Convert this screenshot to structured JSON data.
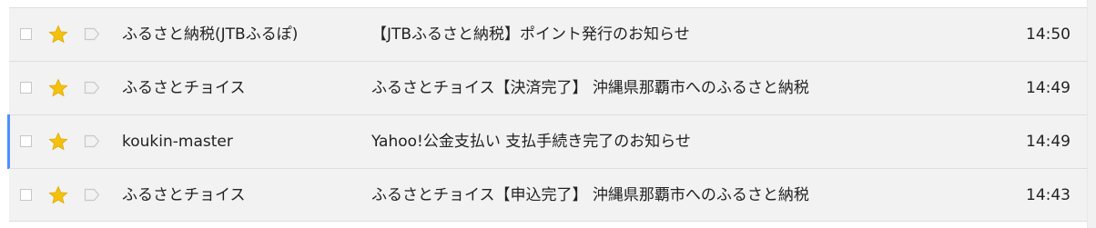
{
  "colors": {
    "row_background": "#f2f2f2",
    "row_border": "#dedede",
    "star": "#f4c20d",
    "selected_indicator": "#4d90fe",
    "text": "#222222"
  },
  "icons": {
    "checkbox": "checkbox-icon",
    "star": "star-icon",
    "importance": "importance-marker-icon"
  },
  "emails": [
    {
      "sender": "ふるさと納税(JTBふるぽ)",
      "subject": "【JTBふるさと納税】ポイント発行のお知らせ",
      "time": "14:50",
      "starred": true,
      "selected": false
    },
    {
      "sender": "ふるさとチョイス",
      "subject": "ふるさとチョイス【決済完了】 沖縄県那覇市へのふるさと納税",
      "time": "14:49",
      "starred": true,
      "selected": false
    },
    {
      "sender": "koukin-master",
      "subject": "Yahoo!公金支払い 支払手続き完了のお知らせ",
      "time": "14:49",
      "starred": true,
      "selected": true
    },
    {
      "sender": "ふるさとチョイス",
      "subject": "ふるさとチョイス【申込完了】 沖縄県那覇市へのふるさと納税",
      "time": "14:43",
      "starred": true,
      "selected": false
    }
  ]
}
